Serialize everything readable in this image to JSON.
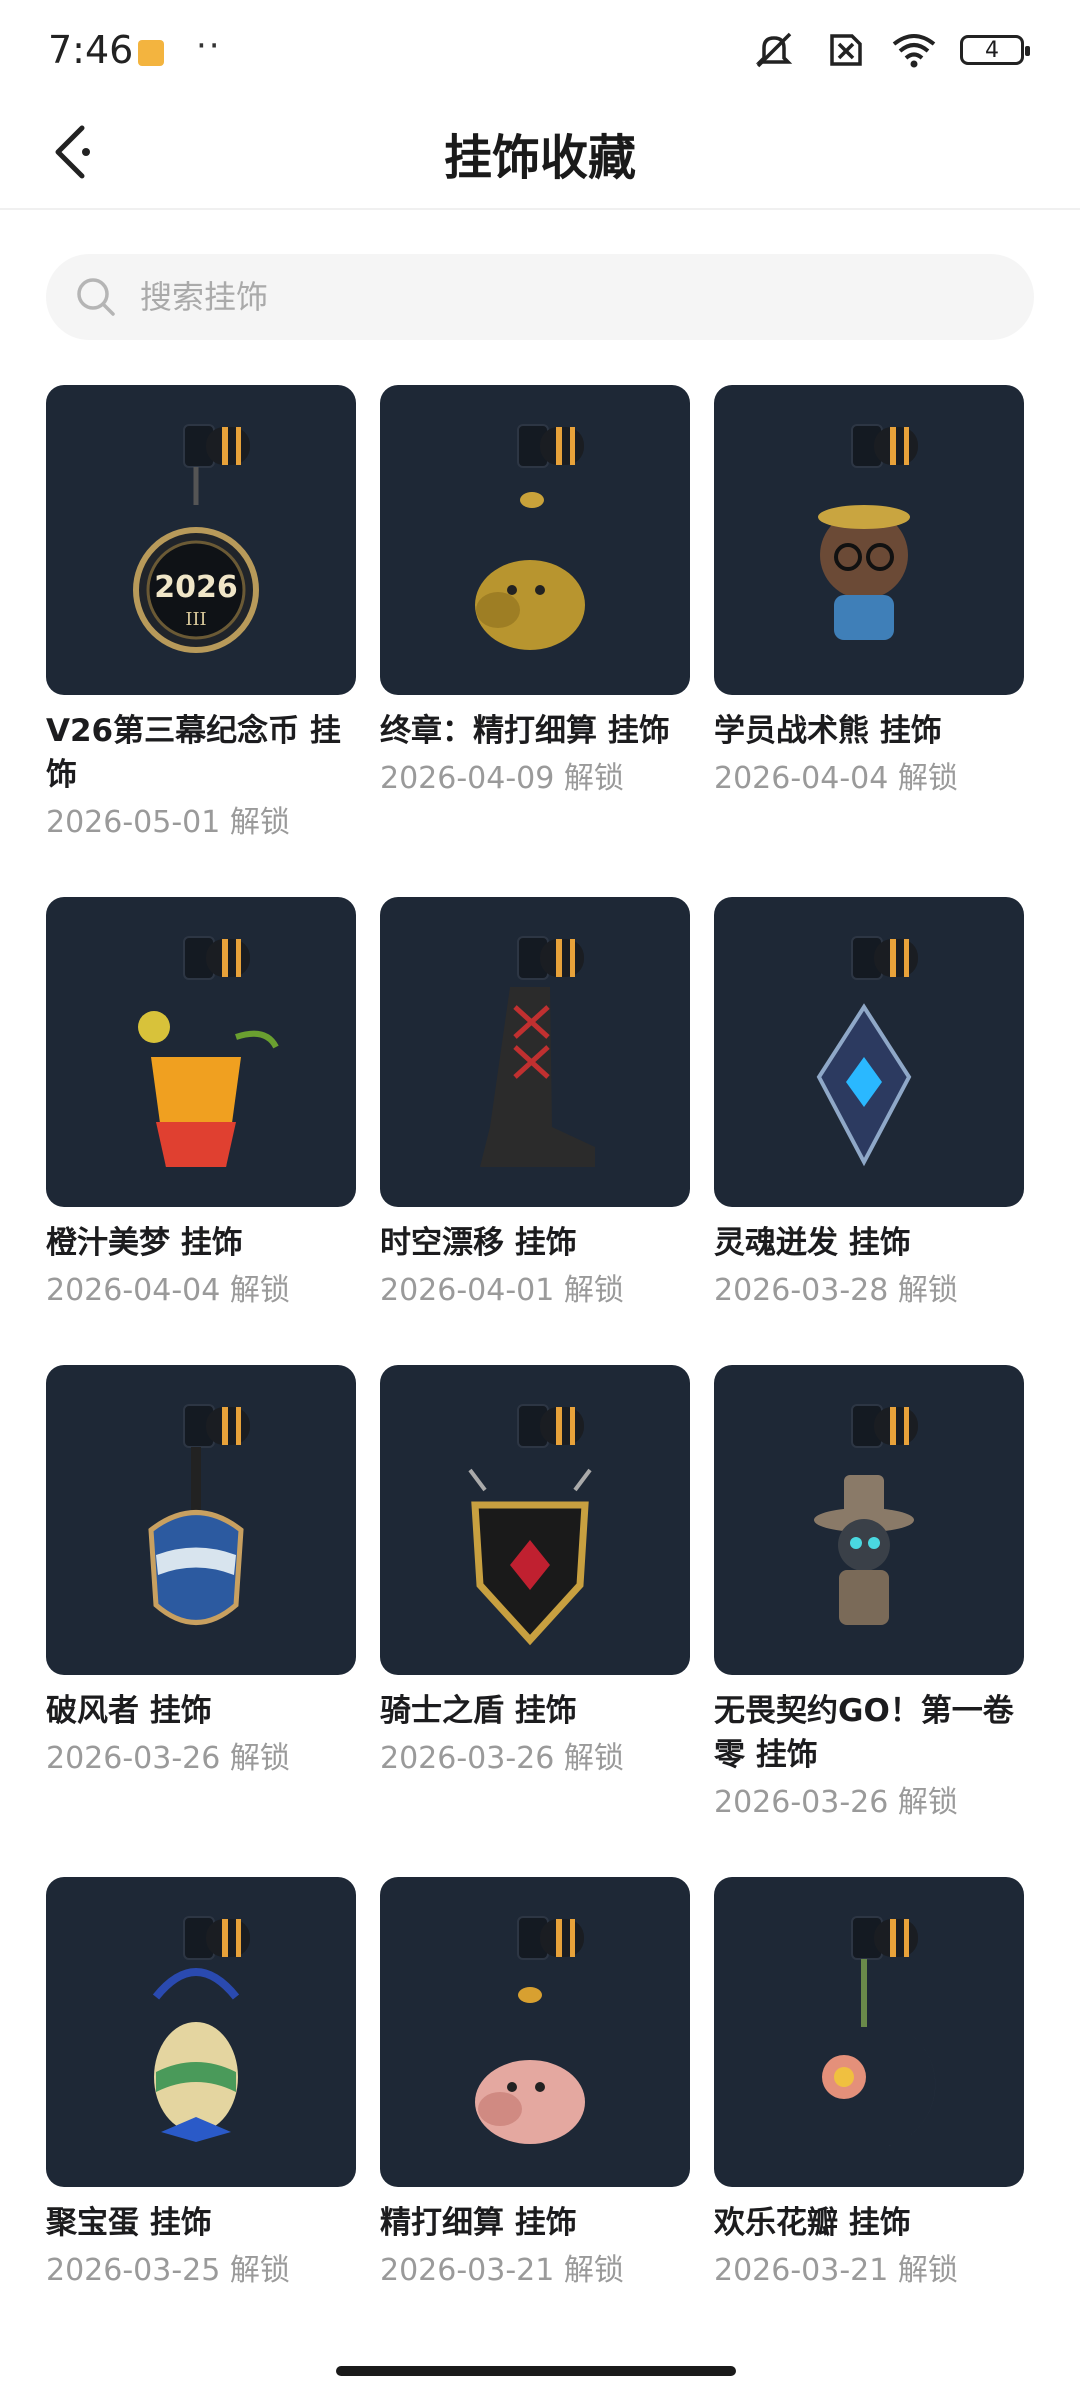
{
  "status_bar": {
    "time": "7:46",
    "dots": "··",
    "battery": "4"
  },
  "header": {
    "title": "挂饰收藏"
  },
  "search": {
    "placeholder": "搜索挂饰"
  },
  "items": [
    {
      "name": "V26第三幕纪念币 挂饰",
      "date": "2026-05-01 解锁",
      "art": "coin",
      "art_text": "2026",
      "art_sub": "III"
    },
    {
      "name": "终章：精打细算 挂饰",
      "date": "2026-04-09 解锁",
      "art": "pig-gold"
    },
    {
      "name": "学员战术熊 挂饰",
      "date": "2026-04-04 解锁",
      "art": "bear"
    },
    {
      "name": "橙汁美梦 挂饰",
      "date": "2026-04-04 解锁",
      "art": "drink"
    },
    {
      "name": "时空漂移 挂饰",
      "date": "2026-04-01 解锁",
      "art": "boot"
    },
    {
      "name": "灵魂迸发 挂饰",
      "date": "2026-03-28 解锁",
      "art": "crystal"
    },
    {
      "name": "破风者 挂饰",
      "date": "2026-03-26 解锁",
      "art": "visor"
    },
    {
      "name": "骑士之盾 挂饰",
      "date": "2026-03-26 解锁",
      "art": "shield"
    },
    {
      "name": "无畏契约GO！第一卷 零 挂饰",
      "date": "2026-03-26 解锁",
      "art": "robot"
    },
    {
      "name": "聚宝蛋 挂饰",
      "date": "2026-03-25 解锁",
      "art": "egg"
    },
    {
      "name": "精打细算 挂饰",
      "date": "2026-03-21 解锁",
      "art": "pig-pink"
    },
    {
      "name": "欢乐花瓣 挂饰",
      "date": "2026-03-21 解锁",
      "art": "flower"
    }
  ]
}
